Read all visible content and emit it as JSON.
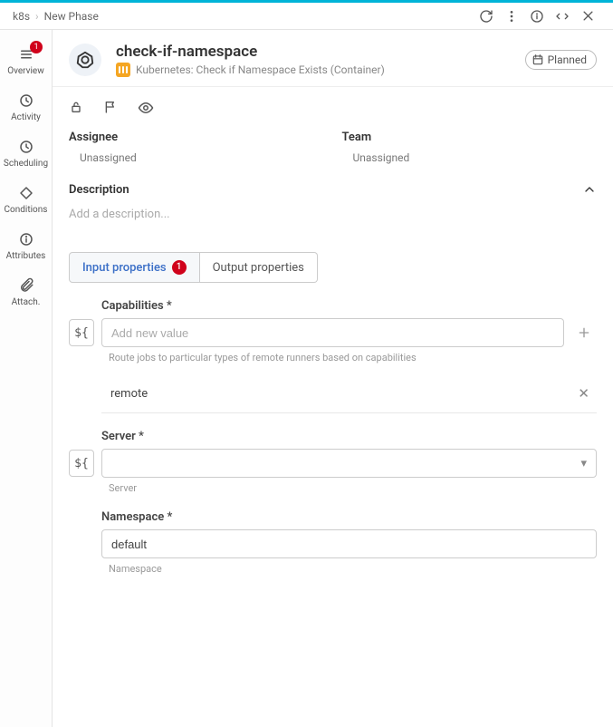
{
  "breadcrumb": {
    "item1": "k8s",
    "item2": "New Phase"
  },
  "header": {
    "title": "check-if-namespace",
    "subtitle": "Kubernetes: Check if Namespace Exists (Container)",
    "status": "Planned"
  },
  "side_nav": {
    "overview": {
      "label": "Overview",
      "badge": "1"
    },
    "activity": {
      "label": "Activity"
    },
    "scheduling": {
      "label": "Scheduling"
    },
    "conditions": {
      "label": "Conditions"
    },
    "attributes": {
      "label": "Attributes"
    },
    "attach": {
      "label": "Attach."
    }
  },
  "assignee": {
    "label": "Assignee",
    "value": "Unassigned"
  },
  "team": {
    "label": "Team",
    "value": "Unassigned"
  },
  "description": {
    "label": "Description",
    "placeholder": "Add a description..."
  },
  "tabs": {
    "input": {
      "label": "Input properties",
      "badge": "1"
    },
    "output": {
      "label": "Output properties"
    }
  },
  "fields": {
    "capabilities": {
      "label": "Capabilities *",
      "placeholder": "Add new value",
      "help": "Route jobs to particular types of remote runners based on capabilities",
      "chip": "remote"
    },
    "server": {
      "label": "Server *",
      "help": "Server"
    },
    "namespace": {
      "label": "Namespace *",
      "value": "default",
      "help": "Namespace"
    }
  },
  "var_btn_text": "${"
}
